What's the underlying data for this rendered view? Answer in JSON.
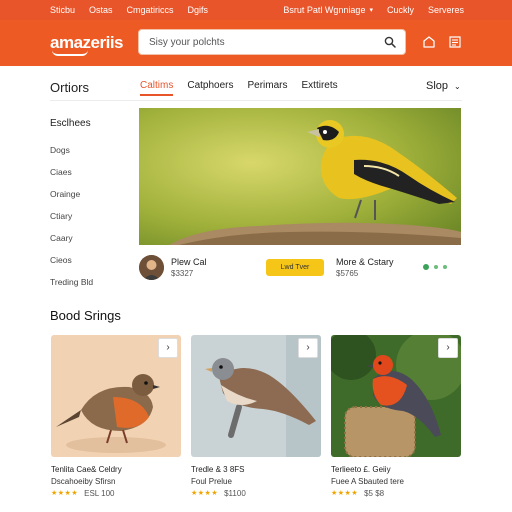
{
  "topbar": {
    "left": [
      "Sticbu",
      "Ostas",
      "Cmgatiriccs",
      "Dgifs"
    ],
    "right": [
      "Bsrut Patl Wgnniage",
      "Cuckly",
      "Serveres"
    ]
  },
  "header": {
    "logo": "amazeriis",
    "search_placeholder": "Sisy your polchts"
  },
  "nav": {
    "side_title": "Ortiors",
    "tabs": [
      "Caltims",
      "Catphoers",
      "Perimars",
      "Exttirets"
    ],
    "shop_label": "Slop"
  },
  "sidebar": {
    "heading": "Esclhees",
    "items": [
      "Dogs",
      "Ciaes",
      "Orainge",
      "Ctiary",
      "Caary",
      "Cieos",
      "Treding Bld"
    ]
  },
  "hero": {
    "name": "Plew Cal",
    "price": "$3327",
    "cta_label": "Lwd Tver",
    "more": "More & Cstary",
    "price2": "$5765"
  },
  "section": {
    "title": "Bood Srings"
  },
  "cards": [
    {
      "title": "Tenlita Cae& Celdry",
      "sub": "Dscahoeiby Sfirsn",
      "price": "ESL 100",
      "rating": 4
    },
    {
      "title": "Tredle & 3 8FS",
      "sub": "Foul Prelue",
      "price": "$1100",
      "rating": 4
    },
    {
      "title": "Terlieeto £. Geiiy",
      "sub": "Fuee A Sbauted tere",
      "price": "$5 $8",
      "rating": 4
    }
  ],
  "colors": {
    "brand": "#ee5a24",
    "accent": "#e8552b",
    "cta": "#f5c518",
    "star": "#f0a500"
  }
}
